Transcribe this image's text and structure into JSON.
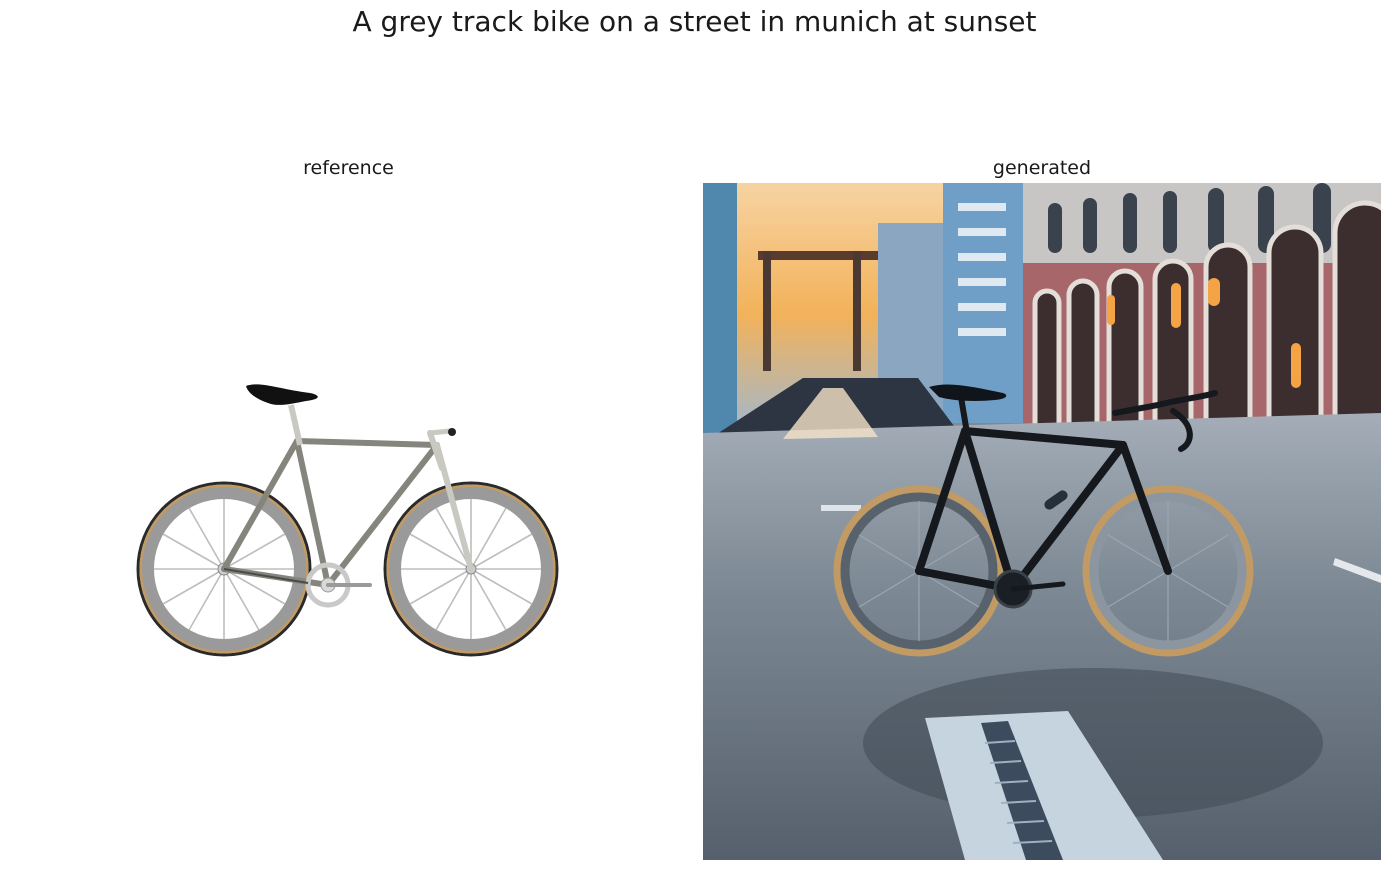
{
  "figure": {
    "title": "A grey track bike on a street in munich at sunset"
  },
  "panels": [
    {
      "title": "reference",
      "image": "grey track bike on white background"
    },
    {
      "title": "generated",
      "image": "black road bike on a street at sunset"
    }
  ],
  "colors": {
    "frame_grey": "#85857d",
    "tire_grey": "#9a9a9a",
    "tire_tan": "#c19a64",
    "sky_orange": "#f2b25a",
    "building_red": "#a7666a",
    "building_blue": "#5f8fb3",
    "road": "#6f7a86"
  }
}
